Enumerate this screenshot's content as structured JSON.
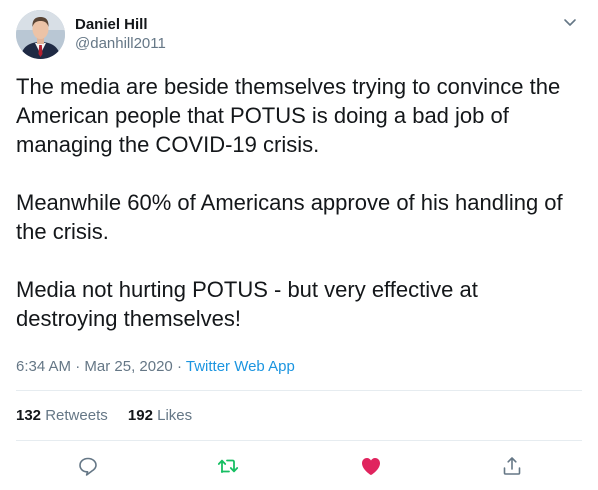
{
  "author": {
    "display_name": "Daniel Hill",
    "handle": "@danhill2011"
  },
  "tweet": {
    "paragraphs": [
      "The media are beside themselves trying to convince the American people that POTUS is doing a bad job of managing the COVID-19 crisis.",
      "Meanwhile 60% of Americans approve of his handling of the crisis.",
      "Media not hurting POTUS - but very effective at destroying themselves!"
    ]
  },
  "meta": {
    "time": "6:34 AM",
    "date": "Mar 25, 2020",
    "separator": "·",
    "app": "Twitter Web App"
  },
  "stats": {
    "retweets_count": "132",
    "retweets_label": "Retweets",
    "likes_count": "192",
    "likes_label": "Likes"
  },
  "actions": {
    "reply_icon": "reply-icon",
    "retweet_icon": "retweet-icon",
    "like_icon": "heart-icon",
    "share_icon": "share-icon"
  },
  "colors": {
    "retweet": "#17bf63",
    "like": "#e0245e",
    "link": "#1b95e0",
    "muted": "#657786"
  }
}
